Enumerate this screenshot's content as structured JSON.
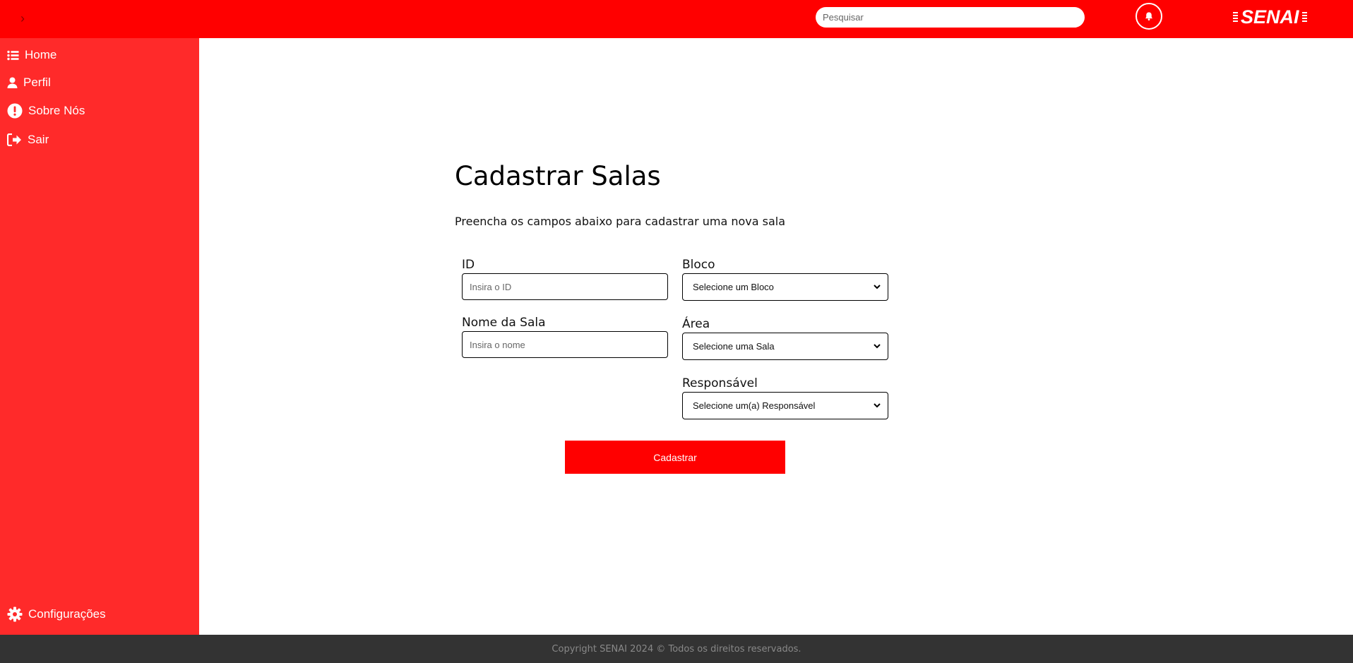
{
  "header": {
    "search_placeholder": "Pesquisar",
    "logo_text": "SENAI"
  },
  "sidebar": {
    "items": [
      {
        "label": "Home",
        "icon": "list-icon"
      },
      {
        "label": "Perfil",
        "icon": "user-icon"
      },
      {
        "label": "Sobre Nós",
        "icon": "exclamation-circle-icon"
      },
      {
        "label": "Sair",
        "icon": "logout-icon"
      }
    ],
    "settings_label": "Configurações"
  },
  "form": {
    "title": "Cadastrar Salas",
    "subtitle": "Preencha os campos abaixo para cadastrar uma nova sala",
    "id_label": "ID",
    "id_placeholder": "Insira o ID",
    "nome_label": "Nome da Sala",
    "nome_placeholder": "Insira o nome",
    "bloco_label": "Bloco",
    "bloco_selected": "Selecione um Bloco",
    "area_label": "Área",
    "area_selected": "Selecione uma Sala",
    "responsavel_label": "Responsável",
    "responsavel_selected": "Selecione um(a) Responsável",
    "submit_label": "Cadastrar"
  },
  "footer": {
    "text": "Copyright SENAI 2024 © Todos os direitos reservados."
  },
  "colors": {
    "header_bg": "#ff0000",
    "sidebar_bg": "#ff2a2a",
    "button_bg": "#ff0000",
    "footer_bg": "#333333"
  }
}
